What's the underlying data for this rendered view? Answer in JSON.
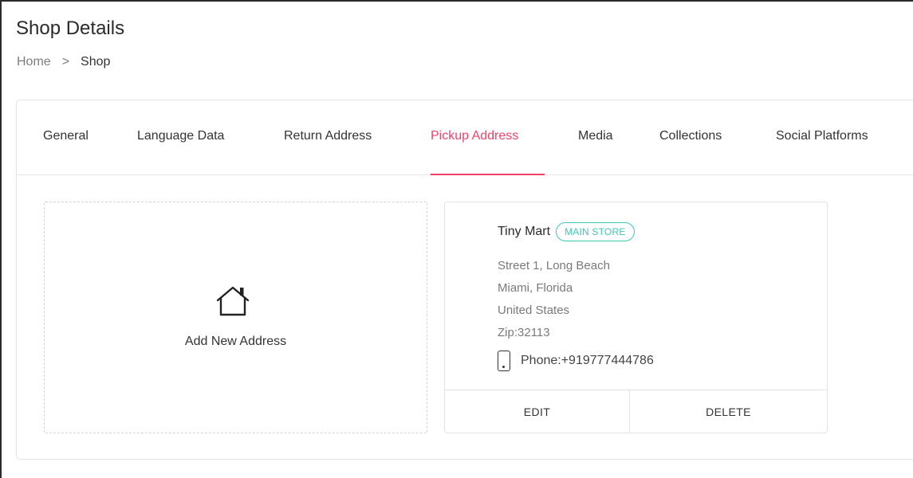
{
  "page": {
    "title": "Shop Details"
  },
  "breadcrumb": {
    "home": "Home",
    "separator": ">",
    "current": "Shop"
  },
  "tabs": [
    {
      "label": "General"
    },
    {
      "label": "Language Data"
    },
    {
      "label": "Return Address"
    },
    {
      "label": "Pickup Address",
      "active": true
    },
    {
      "label": "Media"
    },
    {
      "label": "Collections"
    },
    {
      "label": "Social Platforms"
    }
  ],
  "add_address": {
    "label": "Add New Address",
    "icon": "home-icon"
  },
  "address_card": {
    "name": "Tiny Mart",
    "badge": "MAIN STORE",
    "line1": "Street 1, Long Beach",
    "line2": "Miami, Florida",
    "line3": "United States",
    "zip": "Zip:32113",
    "phone": "Phone:+919777444786",
    "phone_icon": "mobile-phone-icon",
    "edit_label": "EDIT",
    "delete_label": "DELETE"
  },
  "colors": {
    "accent": "#f24268",
    "badge": "#3ec7b5"
  }
}
